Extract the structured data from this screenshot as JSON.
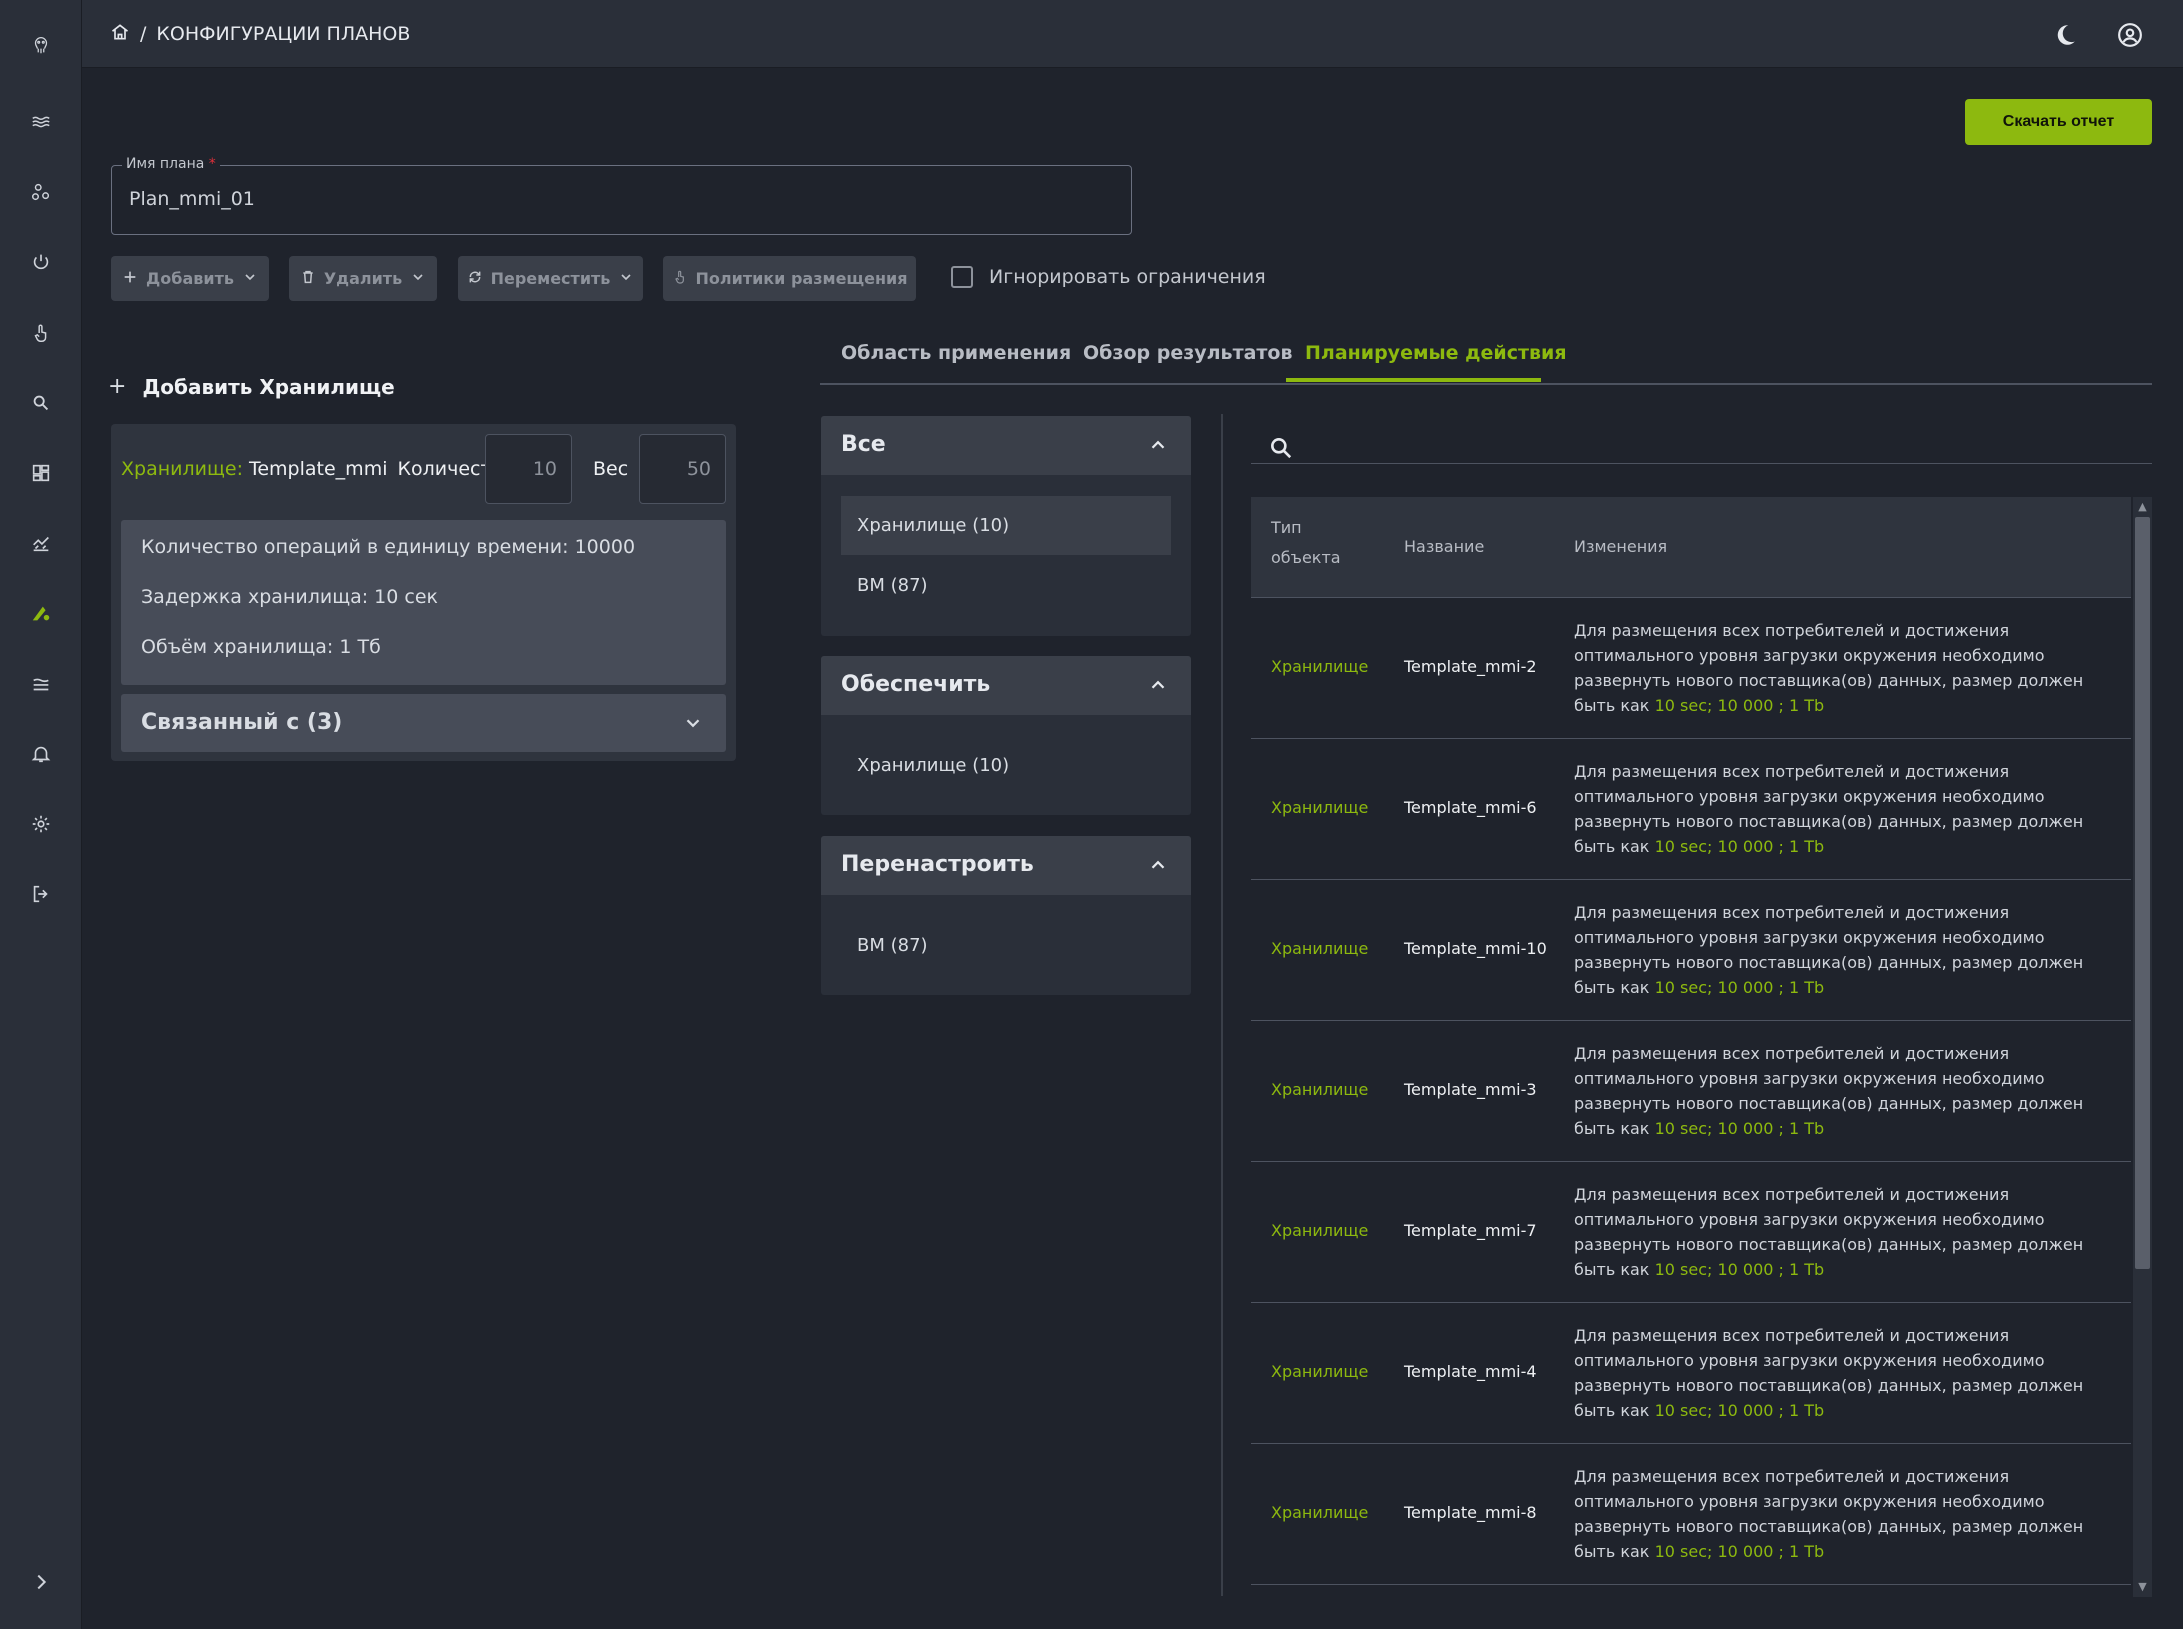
{
  "breadcrumb": {
    "separator": "/",
    "title": "КОНФИГУРАЦИИ ПЛАНОВ"
  },
  "header": {
    "download_label": "Скачать отчет"
  },
  "plan": {
    "label": "Имя плана",
    "required_mark": "*",
    "value": "Plan_mmi_01"
  },
  "toolbar": {
    "add_label": "Добавить",
    "delete_label": "Удалить",
    "move_label": "Переместить",
    "policies_label": "Политики размещения",
    "ignore_label": "Игнорировать ограничения"
  },
  "storage": {
    "add_label": "Добавить Хранилище",
    "key_label": "Хранилище:",
    "name": "Template_mmi",
    "quantity_label": "Количество",
    "quantity_value": "10",
    "weight_label": "Вес",
    "weight_value": "50",
    "info": [
      "Количество операций в единицу времени: 10000",
      "Задержка хранилища: 10 сек",
      "Объём хранилища: 1 Тб"
    ],
    "related_label": "Связанный с (3)"
  },
  "tabs": [
    {
      "label": "Область применения"
    },
    {
      "label": "Обзор результатов"
    },
    {
      "label": "Планируемые действия"
    }
  ],
  "groups": [
    {
      "title": "Все",
      "items": [
        "Хранилище (10)",
        "ВМ (87)"
      ]
    },
    {
      "title": "Обеспечить",
      "items": [
        "Хранилище (10)"
      ]
    },
    {
      "title": "Перенастроить",
      "items": [
        "ВМ (87)"
      ]
    }
  ],
  "table": {
    "headers": {
      "type_line1": "Тип",
      "type_line2": "объекта",
      "name": "Название",
      "changes": "Изменения"
    },
    "change_text": "Для размещения всех потребителей и достижения оптимального уровня загрузки окружения необходимо развернуть нового поставщика(ов) данных, размер должен быть как",
    "change_highlight": "10 sec; 10 000 ; 1 Tb",
    "rows": [
      {
        "type": "Хранилище",
        "name": "Template_mmi-2"
      },
      {
        "type": "Хранилище",
        "name": "Template_mmi-6"
      },
      {
        "type": "Хранилище",
        "name": "Template_mmi-10"
      },
      {
        "type": "Хранилище",
        "name": "Template_mmi-3"
      },
      {
        "type": "Хранилище",
        "name": "Template_mmi-7"
      },
      {
        "type": "Хранилище",
        "name": "Template_mmi-4"
      },
      {
        "type": "Хранилище",
        "name": "Template_mmi-8"
      }
    ]
  },
  "colors": {
    "accent": "#8db90f",
    "background": "#1f232c",
    "panel": "#2a2f39"
  },
  "icons": {
    "rail": [
      "logo-octopus-icon",
      "layers-icon",
      "topology-icon",
      "power-icon",
      "hand-pointer-icon",
      "search-icon",
      "dashboard-icon",
      "analytics-icon",
      "planning-icon",
      "stack-icon",
      "bell-icon",
      "gear-icon",
      "logout-icon",
      "expand-icon"
    ],
    "top": [
      "home-icon",
      "moon-icon",
      "user-icon"
    ]
  }
}
